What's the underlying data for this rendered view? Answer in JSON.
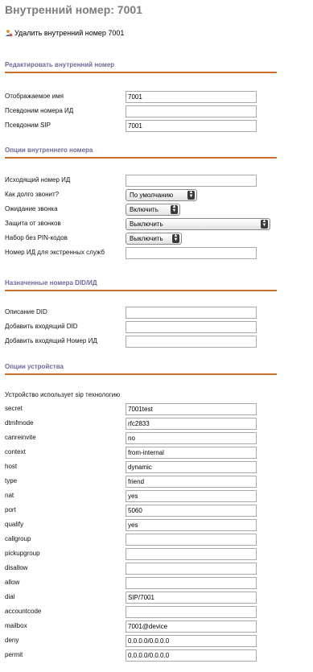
{
  "page": {
    "title": "Внутренний номер: 7001"
  },
  "delete_link": {
    "label": "Удалить внутренний номер 7001",
    "icon": "user-delete-icon"
  },
  "sections": {
    "edit": "Редактировать внутренний номер",
    "options": "Опции внутреннего номера",
    "did": "Назначенные номера DID/ИД",
    "device": "Опции устройства"
  },
  "edit_fields": [
    {
      "label": "Отображаемое имя",
      "value": "7001"
    },
    {
      "label": "Псевдоним номера ИД",
      "value": ""
    },
    {
      "label": "Псевдоним SIP",
      "value": "7001"
    }
  ],
  "options_fields": {
    "outbound_cid": {
      "label": "Исходящий номер ИД",
      "value": ""
    },
    "ring_time": {
      "label": "Как долго звонит?",
      "value": "По умолчанию"
    },
    "call_waiting": {
      "label": "Ожидание звонка",
      "value": "Включить"
    },
    "call_screening": {
      "label": "Защита от звонков",
      "value": "Выключить"
    },
    "pinless": {
      "label": "Набор без PIN-кодов",
      "value": "Выключить"
    },
    "emergency_cid": {
      "label": "Номер ИД для экстренных служб",
      "value": ""
    }
  },
  "did_fields": [
    {
      "label": "Описание DID",
      "value": ""
    },
    {
      "label": "Добавить входящий DID",
      "value": ""
    },
    {
      "label": "Добавить входящий Номер ИД",
      "value": ""
    }
  ],
  "device": {
    "tech_note": "Устройство использует sip технологию",
    "fields": [
      {
        "label": "secret",
        "value": "7001test"
      },
      {
        "label": "dtmfmode",
        "value": "rfc2833"
      },
      {
        "label": "canreinvite",
        "value": "no"
      },
      {
        "label": "context",
        "value": "from-internal"
      },
      {
        "label": "host",
        "value": "dynamic"
      },
      {
        "label": "type",
        "value": "friend"
      },
      {
        "label": "nat",
        "value": "yes"
      },
      {
        "label": "port",
        "value": "5060"
      },
      {
        "label": "qualify",
        "value": "yes"
      },
      {
        "label": "callgroup",
        "value": ""
      },
      {
        "label": "pickupgroup",
        "value": ""
      },
      {
        "label": "disallow",
        "value": ""
      },
      {
        "label": "allow",
        "value": ""
      },
      {
        "label": "dial",
        "value": "SIP/7001"
      },
      {
        "label": "accountcode",
        "value": ""
      },
      {
        "label": "mailbox",
        "value": "7001@device"
      },
      {
        "label": "deny",
        "value": "0.0.0.0/0.0.0.0"
      },
      {
        "label": "permit",
        "value": "0.0.0.0/0.0.0.0"
      }
    ]
  },
  "colors": {
    "section_rule": "#c96f2e",
    "section_title": "#6b6b9a",
    "title": "#7c7c7c"
  }
}
